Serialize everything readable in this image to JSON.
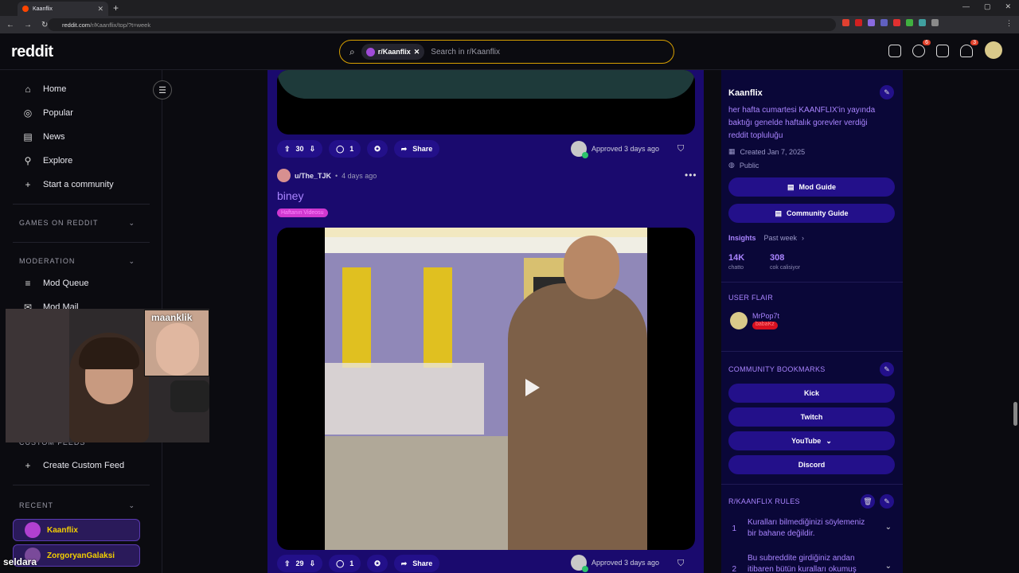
{
  "browser": {
    "tab_title": "Kaanflix",
    "url_host": "reddit.com",
    "url_path": "/r/Kaanflix/top/?t=week"
  },
  "header": {
    "logo": "reddit",
    "search_chip": "r/Kaanflix",
    "search_placeholder": "Search in r/Kaanflix",
    "chat_badge": "6",
    "notif_badge": "3"
  },
  "sidebar": {
    "items": [
      {
        "label": "Home",
        "icon": "home-icon"
      },
      {
        "label": "Popular",
        "icon": "popular-icon"
      },
      {
        "label": "News",
        "icon": "news-icon"
      },
      {
        "label": "Explore",
        "icon": "explore-icon"
      },
      {
        "label": "Start a community",
        "icon": "plus-icon"
      }
    ],
    "games_header": "GAMES ON REDDIT",
    "moderation_header": "MODERATION",
    "mod_items": [
      {
        "label": "Mod Queue",
        "icon": "mod-queue-icon"
      },
      {
        "label": "Mod Mail",
        "icon": "mail-icon"
      }
    ],
    "custom_feeds_header": "CUSTOM FEEDS",
    "create_custom_feed": "Create Custom Feed",
    "recent_header": "RECENT",
    "recent": [
      "Kaanflix",
      "ZorgoryanGalaksi"
    ]
  },
  "overlay": {
    "cam_label": "maanklik",
    "ticker": "seldara"
  },
  "posts": [
    {
      "votes": "30",
      "comments": "1",
      "share": "Share",
      "approved": "Approved 3 days ago"
    },
    {
      "user": "u/The_TJK",
      "time": "4 days ago",
      "title": "biney",
      "flair": "Haftanın Videosu",
      "votes": "29",
      "comments": "1",
      "share": "Share",
      "approved": "Approved 3 days ago"
    }
  ],
  "community": {
    "name": "Kaanflix",
    "description": "her hafta cumartesi KAANFLIX'in yayında baktığı genelde haftalık gorevler verdiği reddit topluluğu",
    "created": "Created Jan 7, 2025",
    "visibility": "Public",
    "mod_guide": "Mod Guide",
    "community_guide": "Community Guide",
    "insights_label": "Insights",
    "insights_period": "Past week",
    "stat1_value": "14K",
    "stat1_label": "chatto",
    "stat2_value": "308",
    "stat2_label": "cok calisiyor",
    "user_flair_header": "USER FLAIR",
    "flair_user": "MrPop7t",
    "flair_tag": "babaKz",
    "bookmarks_header": "COMMUNITY BOOKMARKS",
    "bookmarks": [
      "Kick",
      "Twitch",
      "YouTube",
      "Discord"
    ],
    "rules_header": "R/KAANFLIX RULES",
    "rules": [
      {
        "num": "1",
        "text": "Kuralları bilmediğinizi söylemeniz bir bahane değildir."
      },
      {
        "num": "2",
        "text": "Bu subreddite girdiğiniz andan itibaren bütün kuralları okumuş"
      }
    ]
  }
}
